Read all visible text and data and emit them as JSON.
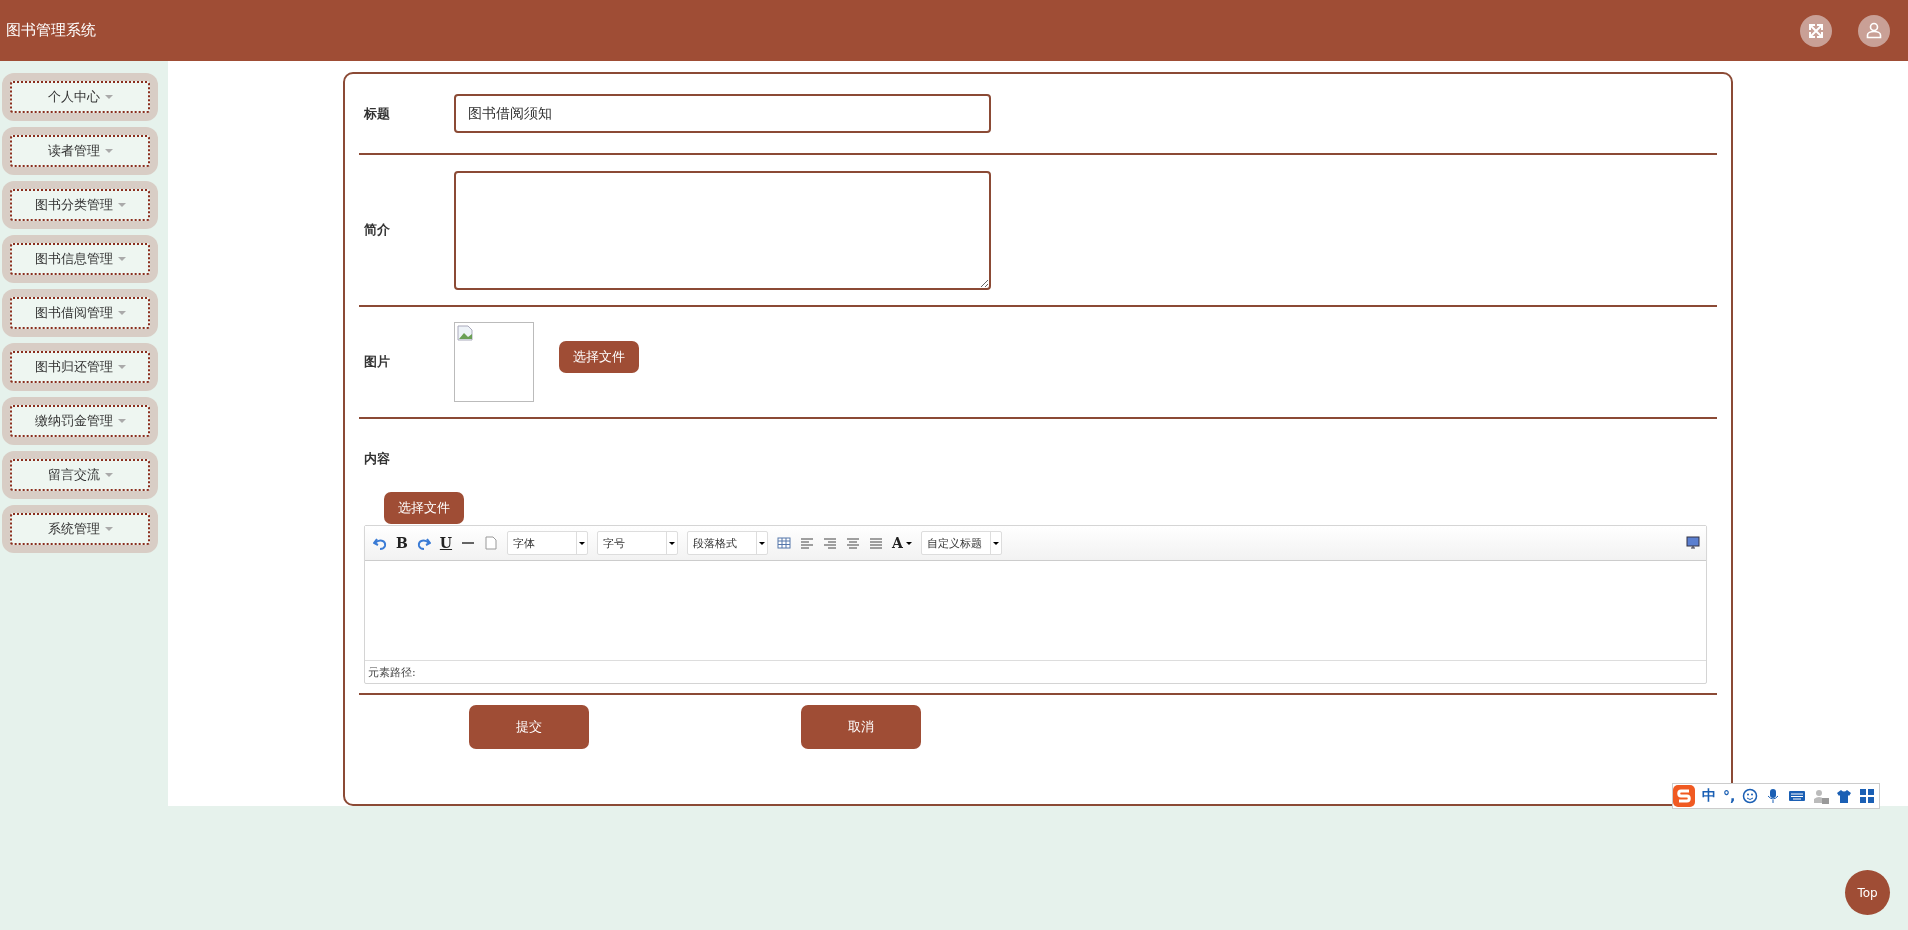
{
  "header": {
    "title": "图书管理系统"
  },
  "sidebar": {
    "items": [
      {
        "label": "个人中心"
      },
      {
        "label": "读者管理"
      },
      {
        "label": "图书分类管理"
      },
      {
        "label": "图书信息管理"
      },
      {
        "label": "图书借阅管理"
      },
      {
        "label": "图书归还管理"
      },
      {
        "label": "缴纳罚金管理"
      },
      {
        "label": "留言交流"
      },
      {
        "label": "系统管理"
      }
    ]
  },
  "form": {
    "title_field": {
      "label": "标题",
      "value": "图书借阅须知"
    },
    "summary_field": {
      "label": "简介"
    },
    "image_field": {
      "label": "图片",
      "button": "选择文件"
    },
    "content_field": {
      "label": "内容",
      "upload_button": "选择文件",
      "editor": {
        "toolbar": [
          {
            "kind": "undo"
          },
          {
            "kind": "bold",
            "label": "B"
          },
          {
            "kind": "redo"
          },
          {
            "kind": "underline",
            "label": "U"
          },
          {
            "kind": "rule"
          },
          {
            "kind": "page"
          },
          {
            "kind": "select",
            "label": "字体"
          },
          {
            "kind": "select",
            "label": "字号"
          },
          {
            "kind": "select",
            "label": "段落格式"
          },
          {
            "kind": "table"
          },
          {
            "kind": "alignleft"
          },
          {
            "kind": "alignright"
          },
          {
            "kind": "aligncenter"
          },
          {
            "kind": "justify"
          },
          {
            "kind": "color",
            "label": "A"
          },
          {
            "kind": "select",
            "label": "自定义标题"
          }
        ],
        "status": "元素路径:"
      }
    },
    "actions": [
      {
        "label": "提交"
      },
      {
        "label": "取消"
      }
    ]
  },
  "ime_bar": {
    "texts": [
      "中",
      "°,"
    ]
  },
  "top_button": "Top"
}
